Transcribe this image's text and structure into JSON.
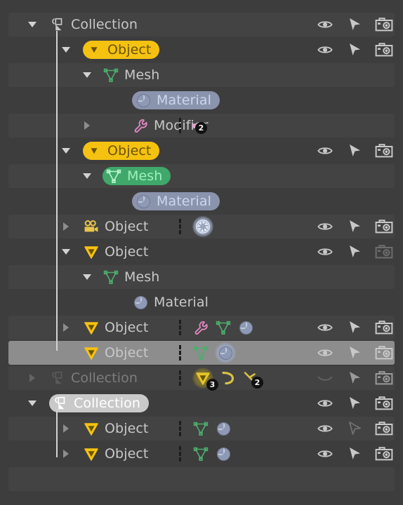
{
  "app": {
    "panel": "outliner",
    "theme": {
      "background": "#3d3d3d",
      "row_alt": "#434343",
      "row_selected": "#8d8d8d",
      "text": "#c8c8c8",
      "text_dim": "#7d7d7d",
      "object_yellow": "#f5c211",
      "mesh_green": "#3fa86a",
      "material_blue": "#8b94ad",
      "collection_gray": "#c9c9c9",
      "tree_line": "#d3d3d3",
      "separator": "#1d1d1d",
      "badge_bg": "#111111",
      "modifier_pink": "#e79fd0"
    }
  },
  "columns": {
    "visibility_label": "Hide in Viewport",
    "selectable_label": "Disable Selection",
    "render_label": "Disable in Renders"
  },
  "rows": [
    {
      "id": "row-0",
      "label": "Collection",
      "type": "collection",
      "depth": 0,
      "expanded": true,
      "pill": "none",
      "dim": false,
      "selected": false,
      "striped": true,
      "icon": "collection-icon",
      "data_icons": [],
      "separator": false,
      "toggles": {
        "visibility": "open-eye-icon",
        "selectable": "cursor-icon",
        "render": "camera-icon",
        "visibility_off": false,
        "selectable_off": false,
        "render_off": false
      }
    },
    {
      "id": "row-1",
      "label": "Object",
      "type": "object",
      "depth": 1,
      "expanded": true,
      "pill": "yellow",
      "dim": false,
      "selected": false,
      "striped": false,
      "icon": "object-mesh-triangle-icon",
      "data_icons": [],
      "separator": false,
      "toggles": {
        "visibility": "open-eye-icon",
        "selectable": "cursor-icon",
        "render": "camera-icon",
        "visibility_off": false,
        "selectable_off": false,
        "render_off": false
      }
    },
    {
      "id": "row-2",
      "label": "Mesh",
      "type": "mesh-data",
      "depth": 2,
      "expanded": true,
      "pill": "none",
      "dim": false,
      "selected": false,
      "striped": true,
      "icon": "mesh-data-icon",
      "data_icons": [],
      "separator": false,
      "toggles": null
    },
    {
      "id": "row-3",
      "label": "Material",
      "type": "material",
      "depth": 3,
      "expanded": null,
      "pill": "blue",
      "dim": false,
      "selected": false,
      "striped": false,
      "icon": "material-sphere-icon",
      "data_icons": [],
      "separator": false,
      "toggles": null
    },
    {
      "id": "row-4",
      "label": "Modifier",
      "type": "modifier",
      "depth": 3,
      "expanded": false,
      "pill": "none",
      "dim": false,
      "selected": false,
      "striped": true,
      "icon": "wrench-icon",
      "data_icons": [
        {
          "icon": "modifier-dot-icon",
          "badge": "2",
          "glow": false
        }
      ],
      "separator": true,
      "toggles": null
    },
    {
      "id": "row-5",
      "label": "Object",
      "type": "object",
      "depth": 1,
      "expanded": true,
      "pill": "yellow",
      "dim": false,
      "selected": false,
      "striped": false,
      "icon": "object-mesh-triangle-icon",
      "data_icons": [],
      "separator": false,
      "toggles": {
        "visibility": "open-eye-icon",
        "selectable": "cursor-icon",
        "render": "camera-icon",
        "visibility_off": false,
        "selectable_off": false,
        "render_off": false
      }
    },
    {
      "id": "row-6",
      "label": "Mesh",
      "type": "mesh-data",
      "depth": 2,
      "expanded": true,
      "pill": "green",
      "dim": false,
      "selected": false,
      "striped": true,
      "icon": "mesh-data-icon",
      "data_icons": [],
      "separator": false,
      "toggles": null
    },
    {
      "id": "row-7",
      "label": "Material",
      "type": "material",
      "depth": 3,
      "expanded": null,
      "pill": "blue",
      "dim": false,
      "selected": false,
      "striped": false,
      "icon": "material-sphere-icon",
      "data_icons": [],
      "separator": false,
      "toggles": null
    },
    {
      "id": "row-8",
      "label": "Object",
      "type": "camera-object",
      "depth": 1,
      "expanded": false,
      "pill": "none",
      "dim": false,
      "selected": false,
      "striped": true,
      "icon": "movie-camera-icon",
      "data_icons": [
        {
          "icon": "camera-data-icon",
          "badge": null,
          "glow": true
        }
      ],
      "separator": true,
      "toggles": {
        "visibility": "open-eye-icon",
        "selectable": "cursor-icon",
        "render": "camera-icon",
        "visibility_off": false,
        "selectable_off": false,
        "render_off": false
      }
    },
    {
      "id": "row-9",
      "label": "Object",
      "type": "object",
      "depth": 1,
      "expanded": true,
      "pill": "none",
      "dim": false,
      "selected": false,
      "striped": false,
      "icon": "object-mesh-triangle-icon",
      "data_icons": [],
      "separator": false,
      "toggles": {
        "visibility": "open-eye-icon",
        "selectable": "cursor-icon",
        "render": "camera-icon",
        "visibility_off": false,
        "selectable_off": false,
        "render_off": true
      }
    },
    {
      "id": "row-10",
      "label": "Mesh",
      "type": "mesh-data",
      "depth": 2,
      "expanded": true,
      "pill": "none",
      "dim": false,
      "selected": false,
      "striped": true,
      "icon": "mesh-data-icon",
      "data_icons": [],
      "separator": false,
      "toggles": null
    },
    {
      "id": "row-11",
      "label": "Material",
      "type": "material",
      "depth": 3,
      "expanded": null,
      "pill": "none",
      "dim": false,
      "selected": false,
      "striped": false,
      "icon": "material-sphere-icon",
      "data_icons": [],
      "separator": false,
      "toggles": null
    },
    {
      "id": "row-12",
      "label": "Object",
      "type": "object",
      "depth": 1,
      "expanded": false,
      "pill": "none",
      "dim": false,
      "selected": false,
      "striped": true,
      "icon": "object-mesh-triangle-icon",
      "data_icons": [
        {
          "icon": "wrench-icon",
          "badge": null,
          "glow": false
        },
        {
          "icon": "mesh-data-icon",
          "badge": null,
          "glow": false
        },
        {
          "icon": "material-sphere-icon",
          "badge": null,
          "glow": false
        }
      ],
      "separator": true,
      "toggles": {
        "visibility": "open-eye-icon",
        "selectable": "cursor-icon",
        "render": "camera-icon",
        "visibility_off": false,
        "selectable_off": false,
        "render_off": false
      }
    },
    {
      "id": "row-13",
      "label": "Object",
      "type": "object",
      "depth": 1,
      "expanded": false,
      "pill": "none",
      "dim": false,
      "selected": true,
      "striped": false,
      "icon": "object-mesh-triangle-icon",
      "data_icons": [
        {
          "icon": "mesh-data-icon",
          "badge": null,
          "glow": false
        },
        {
          "icon": "material-sphere-icon",
          "badge": null,
          "glow": true
        }
      ],
      "separator": true,
      "toggles": {
        "visibility": "open-eye-icon",
        "selectable": "cursor-icon",
        "render": "camera-icon",
        "visibility_off": false,
        "selectable_off": false,
        "render_off": false
      }
    },
    {
      "id": "row-14",
      "label": "Collection",
      "type": "collection",
      "depth": 0,
      "expanded": false,
      "pill": "none",
      "dim": true,
      "selected": false,
      "striped": true,
      "icon": "collection-icon",
      "data_icons": [
        {
          "icon": "object-mesh-triangle-icon",
          "badge": "3",
          "glow": true
        },
        {
          "icon": "curve-data-icon",
          "badge": null,
          "glow": false
        },
        {
          "icon": "armature-bone-icon",
          "badge": "2",
          "glow": false
        }
      ],
      "separator": true,
      "toggles": {
        "visibility": "closed-eye-icon",
        "selectable": "cursor-icon",
        "render": "camera-icon",
        "visibility_off": true,
        "selectable_off": false,
        "render_off": false
      }
    },
    {
      "id": "row-15",
      "label": "Collection",
      "type": "collection",
      "depth": 0,
      "expanded": true,
      "pill": "gray",
      "dim": false,
      "selected": false,
      "striped": false,
      "icon": "collection-icon",
      "data_icons": [],
      "separator": false,
      "toggles": {
        "visibility": "open-eye-icon",
        "selectable": "cursor-icon",
        "render": "camera-icon",
        "visibility_off": false,
        "selectable_off": false,
        "render_off": false
      }
    },
    {
      "id": "row-16",
      "label": "Object",
      "type": "object",
      "depth": 1,
      "expanded": false,
      "pill": "none",
      "dim": false,
      "selected": false,
      "striped": true,
      "icon": "object-mesh-triangle-icon",
      "data_icons": [
        {
          "icon": "mesh-data-icon",
          "badge": null,
          "glow": false
        },
        {
          "icon": "material-sphere-icon",
          "badge": null,
          "glow": false
        }
      ],
      "separator": true,
      "toggles": {
        "visibility": "open-eye-icon",
        "selectable": "cursor-outline-icon",
        "render": "camera-icon",
        "visibility_off": false,
        "selectable_off": true,
        "render_off": false
      }
    },
    {
      "id": "row-17",
      "label": "Object",
      "type": "object",
      "depth": 1,
      "expanded": false,
      "pill": "none",
      "dim": false,
      "selected": false,
      "striped": false,
      "icon": "object-mesh-triangle-icon",
      "data_icons": [
        {
          "icon": "mesh-data-icon",
          "badge": null,
          "glow": false
        },
        {
          "icon": "material-sphere-icon",
          "badge": null,
          "glow": false
        }
      ],
      "separator": true,
      "toggles": {
        "visibility": "open-eye-icon",
        "selectable": "cursor-icon",
        "render": "camera-icon",
        "visibility_off": false,
        "selectable_off": false,
        "render_off": false
      }
    },
    {
      "id": "row-18",
      "label": "",
      "type": "empty",
      "depth": 0,
      "expanded": null,
      "pill": "none",
      "dim": false,
      "selected": false,
      "striped": true,
      "icon": null,
      "data_icons": [],
      "separator": false,
      "toggles": null
    }
  ]
}
